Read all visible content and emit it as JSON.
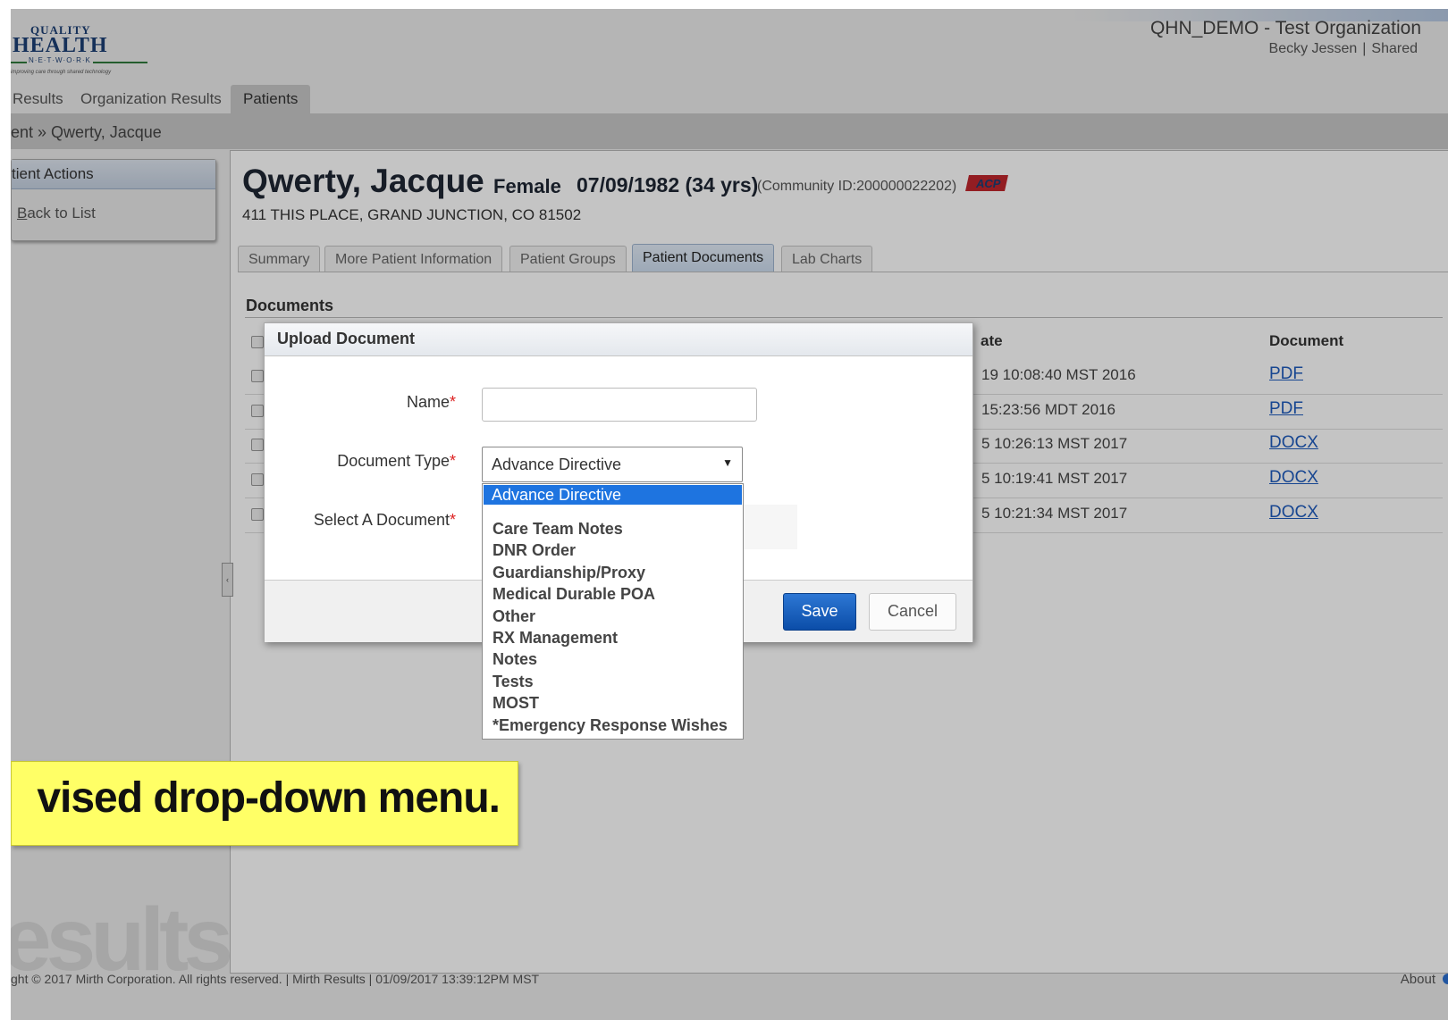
{
  "header": {
    "logo_line1": "QUALITY",
    "logo_line2": "HEALTH",
    "logo_line3": "N·E·T·W·O·R·K",
    "logo_tagline": "improving care through shared technology",
    "organization": "QHN_DEMO - Test Organization",
    "user": "Becky Jessen",
    "user_mode": "Shared",
    "separator": "|"
  },
  "main_tabs": [
    "Results",
    "Organization Results",
    "Patients"
  ],
  "active_main_tab": "Patients",
  "breadcrumb": "ent » Qwerty, Jacque",
  "sidebar": {
    "header": "tient Actions",
    "back_link_first": "B",
    "back_link_rest": "ack to List"
  },
  "patient": {
    "name": "Qwerty, Jacque",
    "gender": "Female",
    "dob": "07/09/1982 (34 yrs)",
    "community": "(Community ID:200000022202)",
    "flag": "ACP",
    "address": "411 THIS PLACE, GRAND JUNCTION, CO 81502"
  },
  "patient_tabs": [
    "Summary",
    "More Patient Information",
    "Patient Groups",
    "Patient Documents",
    "Lab Charts"
  ],
  "active_patient_tab": "Patient Documents",
  "documents": {
    "title": "Documents",
    "col_date": "ate",
    "col_document": "Document",
    "rows": [
      {
        "date": "19 10:08:40 MST 2016",
        "doc": "PDF"
      },
      {
        "date": " 15:23:56 MDT 2016",
        "doc": "PDF"
      },
      {
        "date": "5 10:26:13 MST 2017",
        "doc": "DOCX"
      },
      {
        "date": "5 10:19:41 MST 2017",
        "doc": "DOCX"
      },
      {
        "date": "5 10:21:34 MST 2017",
        "doc": "DOCX"
      }
    ]
  },
  "dialog": {
    "title": "Upload Document",
    "name_label": "Name",
    "name_value": "",
    "doc_type_label": "Document Type",
    "doc_type_value": "Advance Directive",
    "select_doc_label": "Select A Document",
    "required_mark": "*",
    "save": "Save",
    "cancel": "Cancel"
  },
  "dropdown": {
    "selected": "Advance Directive",
    "options": [
      "Care Team Notes",
      "DNR Order",
      "Guardianship/Proxy",
      "Medical Durable POA",
      "Other",
      "RX Management",
      "Notes",
      "Tests",
      "MOST",
      "*Emergency Response Wishes"
    ]
  },
  "caption": "vised drop-down menu.",
  "watermark": "esults",
  "footer": "ght © 2017 Mirth Corporation. All rights reserved. | Mirth Results | 01/09/2017 13:39:12PM MST",
  "about": "About",
  "colors": {
    "accent": "#1e74e0",
    "save_button": "#0b4da8",
    "link": "#1f5bbd",
    "caption_bg": "#ffff66",
    "flag": "#c0262d"
  }
}
